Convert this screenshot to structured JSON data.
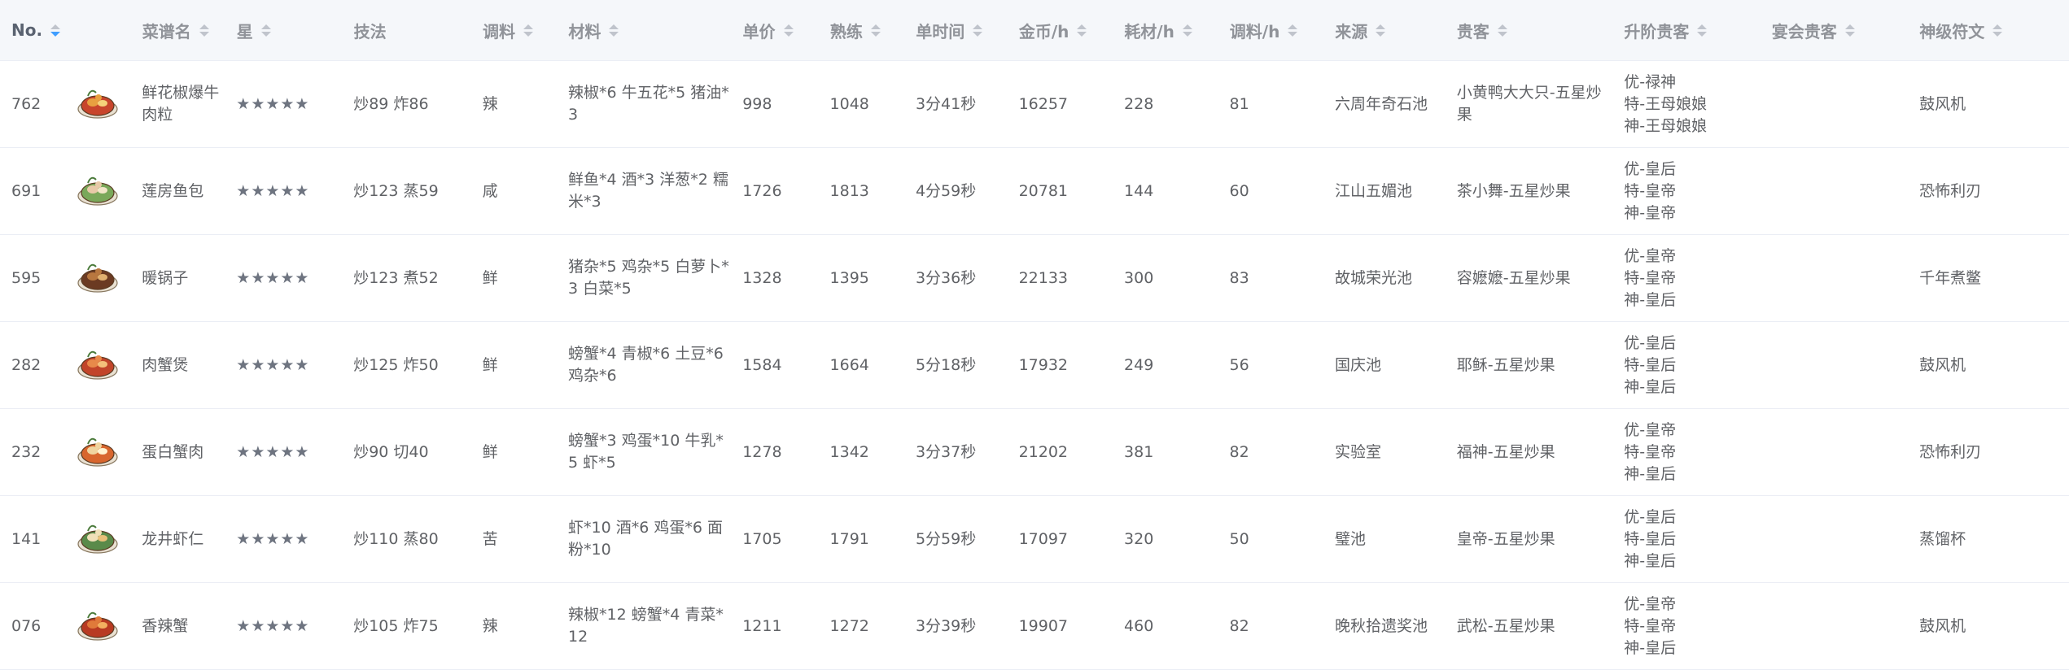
{
  "columns": [
    {
      "key": "no",
      "label": "No.",
      "sortable": true,
      "active": true
    },
    {
      "key": "img",
      "label": "",
      "sortable": false
    },
    {
      "key": "name",
      "label": "菜谱名",
      "sortable": true
    },
    {
      "key": "star",
      "label": "星",
      "sortable": true
    },
    {
      "key": "skill",
      "label": "技法",
      "sortable": false
    },
    {
      "key": "seasoning",
      "label": "调料",
      "sortable": true
    },
    {
      "key": "materials",
      "label": "材料",
      "sortable": true
    },
    {
      "key": "price",
      "label": "单价",
      "sortable": true
    },
    {
      "key": "proficiency",
      "label": "熟练",
      "sortable": true
    },
    {
      "key": "time",
      "label": "单时间",
      "sortable": true
    },
    {
      "key": "gold_h",
      "label": "金币/h",
      "sortable": true
    },
    {
      "key": "mat_h",
      "label": "耗材/h",
      "sortable": true
    },
    {
      "key": "season_h",
      "label": "调料/h",
      "sortable": true
    },
    {
      "key": "source",
      "label": "来源",
      "sortable": true
    },
    {
      "key": "guest",
      "label": "贵客",
      "sortable": true
    },
    {
      "key": "upgrade",
      "label": "升阶贵客",
      "sortable": true
    },
    {
      "key": "banquet",
      "label": "宴会贵客",
      "sortable": true
    },
    {
      "key": "rune",
      "label": "神级符文",
      "sortable": true
    }
  ],
  "rows": [
    {
      "no": "762",
      "name": "鲜花椒爆牛肉粒",
      "star": "★★★★★",
      "skill": "炒89 炸86",
      "seasoning": "辣",
      "materials": "辣椒*6 牛五花*5 猪油*3",
      "price": "998",
      "proficiency": "1048",
      "time": "3分41秒",
      "gold_h": "16257",
      "mat_h": "228",
      "season_h": "81",
      "source": "六周年奇石池",
      "guest": "小黄鸭大大只-五星炒果",
      "upgrade": [
        "优-禄神",
        "特-王母娘娘",
        "神-王母娘娘"
      ],
      "banquet": "",
      "rune": "鼓风机",
      "icon": "dish-icon-1"
    },
    {
      "no": "691",
      "name": "莲房鱼包",
      "star": "★★★★★",
      "skill": "炒123 蒸59",
      "seasoning": "咸",
      "materials": "鲜鱼*4 酒*3 洋葱*2 糯米*3",
      "price": "1726",
      "proficiency": "1813",
      "time": "4分59秒",
      "gold_h": "20781",
      "mat_h": "144",
      "season_h": "60",
      "source": "江山五媚池",
      "guest": "茶小舞-五星炒果",
      "upgrade": [
        "优-皇后",
        "特-皇帝",
        "神-皇帝"
      ],
      "banquet": "",
      "rune": "恐怖利刃",
      "icon": "dish-icon-2"
    },
    {
      "no": "595",
      "name": "暖锅子",
      "star": "★★★★★",
      "skill": "炒123 煮52",
      "seasoning": "鲜",
      "materials": "猪杂*5 鸡杂*5 白萝卜*3 白菜*5",
      "price": "1328",
      "proficiency": "1395",
      "time": "3分36秒",
      "gold_h": "22133",
      "mat_h": "300",
      "season_h": "83",
      "source": "故城荣光池",
      "guest": "容嬷嬷-五星炒果",
      "upgrade": [
        "优-皇帝",
        "特-皇帝",
        "神-皇后"
      ],
      "banquet": "",
      "rune": "千年煮鳖",
      "icon": "dish-icon-3"
    },
    {
      "no": "282",
      "name": "肉蟹煲",
      "star": "★★★★★",
      "skill": "炒125 炸50",
      "seasoning": "鲜",
      "materials": "螃蟹*4 青椒*6 土豆*6 鸡杂*6",
      "price": "1584",
      "proficiency": "1664",
      "time": "5分18秒",
      "gold_h": "17932",
      "mat_h": "249",
      "season_h": "56",
      "source": "国庆池",
      "guest": "耶稣-五星炒果",
      "upgrade": [
        "优-皇后",
        "特-皇后",
        "神-皇后"
      ],
      "banquet": "",
      "rune": "鼓风机",
      "icon": "dish-icon-4"
    },
    {
      "no": "232",
      "name": "蛋白蟹肉",
      "star": "★★★★★",
      "skill": "炒90 切40",
      "seasoning": "鲜",
      "materials": "螃蟹*3 鸡蛋*10 牛乳*5 虾*5",
      "price": "1278",
      "proficiency": "1342",
      "time": "3分37秒",
      "gold_h": "21202",
      "mat_h": "381",
      "season_h": "82",
      "source": "实验室",
      "guest": "福神-五星炒果",
      "upgrade": [
        "优-皇帝",
        "特-皇帝",
        "神-皇后"
      ],
      "banquet": "",
      "rune": "恐怖利刃",
      "icon": "dish-icon-5"
    },
    {
      "no": "141",
      "name": "龙井虾仁",
      "star": "★★★★★",
      "skill": "炒110 蒸80",
      "seasoning": "苦",
      "materials": "虾*10 酒*6 鸡蛋*6 面粉*10",
      "price": "1705",
      "proficiency": "1791",
      "time": "5分59秒",
      "gold_h": "17097",
      "mat_h": "320",
      "season_h": "50",
      "source": "璧池",
      "guest": "皇帝-五星炒果",
      "upgrade": [
        "优-皇后",
        "特-皇后",
        "神-皇后"
      ],
      "banquet": "",
      "rune": "蒸馏杯",
      "icon": "dish-icon-6"
    },
    {
      "no": "076",
      "name": "香辣蟹",
      "star": "★★★★★",
      "skill": "炒105 炸75",
      "seasoning": "辣",
      "materials": "辣椒*12 螃蟹*4 青菜*12",
      "price": "1211",
      "proficiency": "1272",
      "time": "3分39秒",
      "gold_h": "19907",
      "mat_h": "460",
      "season_h": "82",
      "source": "晚秋拾遗奖池",
      "guest": "武松-五星炒果",
      "upgrade": [
        "优-皇帝",
        "特-皇帝",
        "神-皇后"
      ],
      "banquet": "",
      "rune": "鼓风机",
      "icon": "dish-icon-7"
    }
  ]
}
